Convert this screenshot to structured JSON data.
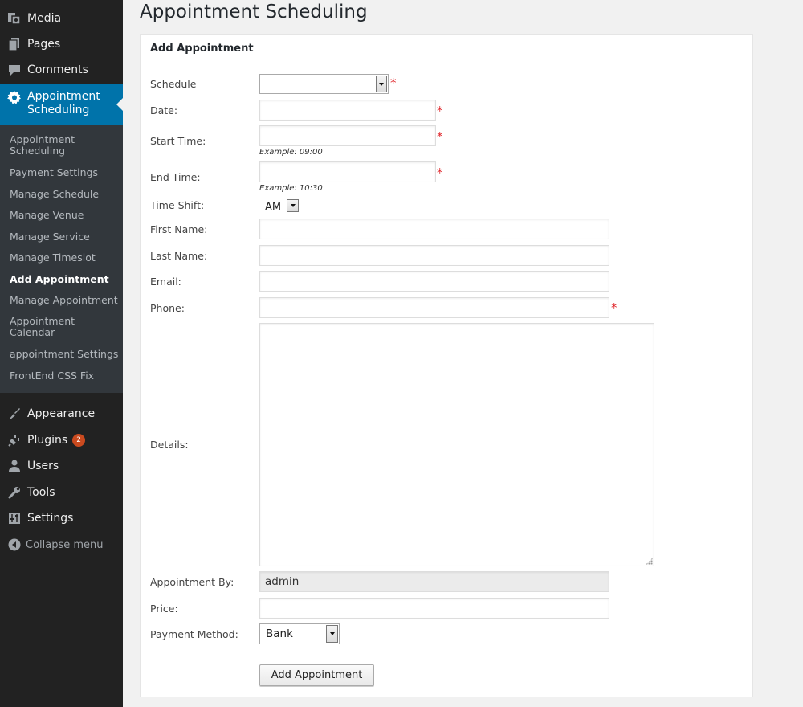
{
  "sidebar": {
    "top_items": [
      {
        "label": "Media",
        "icon": "media-icon"
      },
      {
        "label": "Pages",
        "icon": "pages-icon"
      },
      {
        "label": "Comments",
        "icon": "comments-icon"
      }
    ],
    "current_item": {
      "label": "Appointment Scheduling",
      "icon": "gear-icon"
    },
    "submenu": [
      {
        "label": "Appointment Scheduling",
        "active": false
      },
      {
        "label": "Payment Settings",
        "active": false
      },
      {
        "label": "Manage Schedule",
        "active": false
      },
      {
        "label": "Manage Venue",
        "active": false
      },
      {
        "label": "Manage Service",
        "active": false
      },
      {
        "label": "Manage Timeslot",
        "active": false
      },
      {
        "label": "Add Appointment",
        "active": true
      },
      {
        "label": "Manage Appointment",
        "active": false
      },
      {
        "label": "Appointment Calendar",
        "active": false
      },
      {
        "label": "appointment Settings",
        "active": false
      },
      {
        "label": "FrontEnd CSS Fix",
        "active": false
      }
    ],
    "bottom_items": [
      {
        "label": "Appearance",
        "icon": "paintbrush-icon"
      },
      {
        "label": "Plugins",
        "icon": "plug-icon",
        "badge": "2"
      },
      {
        "label": "Users",
        "icon": "user-icon"
      },
      {
        "label": "Tools",
        "icon": "wrench-icon"
      },
      {
        "label": "Settings",
        "icon": "sliders-icon"
      }
    ],
    "collapse_label": "Collapse menu"
  },
  "page": {
    "title": "Appointment Scheduling"
  },
  "form": {
    "panel_title": "Add Appointment",
    "schedule": {
      "label": "Schedule",
      "value": ""
    },
    "date": {
      "label": "Date:",
      "value": ""
    },
    "start_time": {
      "label": "Start Time:",
      "value": "",
      "hint": "Example: 09:00"
    },
    "end_time": {
      "label": "End Time:",
      "value": "",
      "hint": "Example: 10:30"
    },
    "time_shift": {
      "label": "Time Shift:",
      "value": "AM"
    },
    "first_name": {
      "label": "First Name:",
      "value": ""
    },
    "last_name": {
      "label": "Last Name:",
      "value": ""
    },
    "email": {
      "label": "Email:",
      "value": ""
    },
    "phone": {
      "label": "Phone:",
      "value": ""
    },
    "details": {
      "label": "Details:",
      "value": ""
    },
    "appointment_by": {
      "label": "Appointment By:",
      "value": "admin"
    },
    "price": {
      "label": "Price:",
      "value": ""
    },
    "payment_method": {
      "label": "Payment Method:",
      "value": "Bank"
    },
    "required_mark": "*",
    "submit_label": "Add Appointment"
  },
  "colors": {
    "sidebar_bg": "#222222",
    "submenu_bg": "#32373c",
    "accent": "#0073aa",
    "required": "#e0262b",
    "badge": "#ca4a1f"
  }
}
